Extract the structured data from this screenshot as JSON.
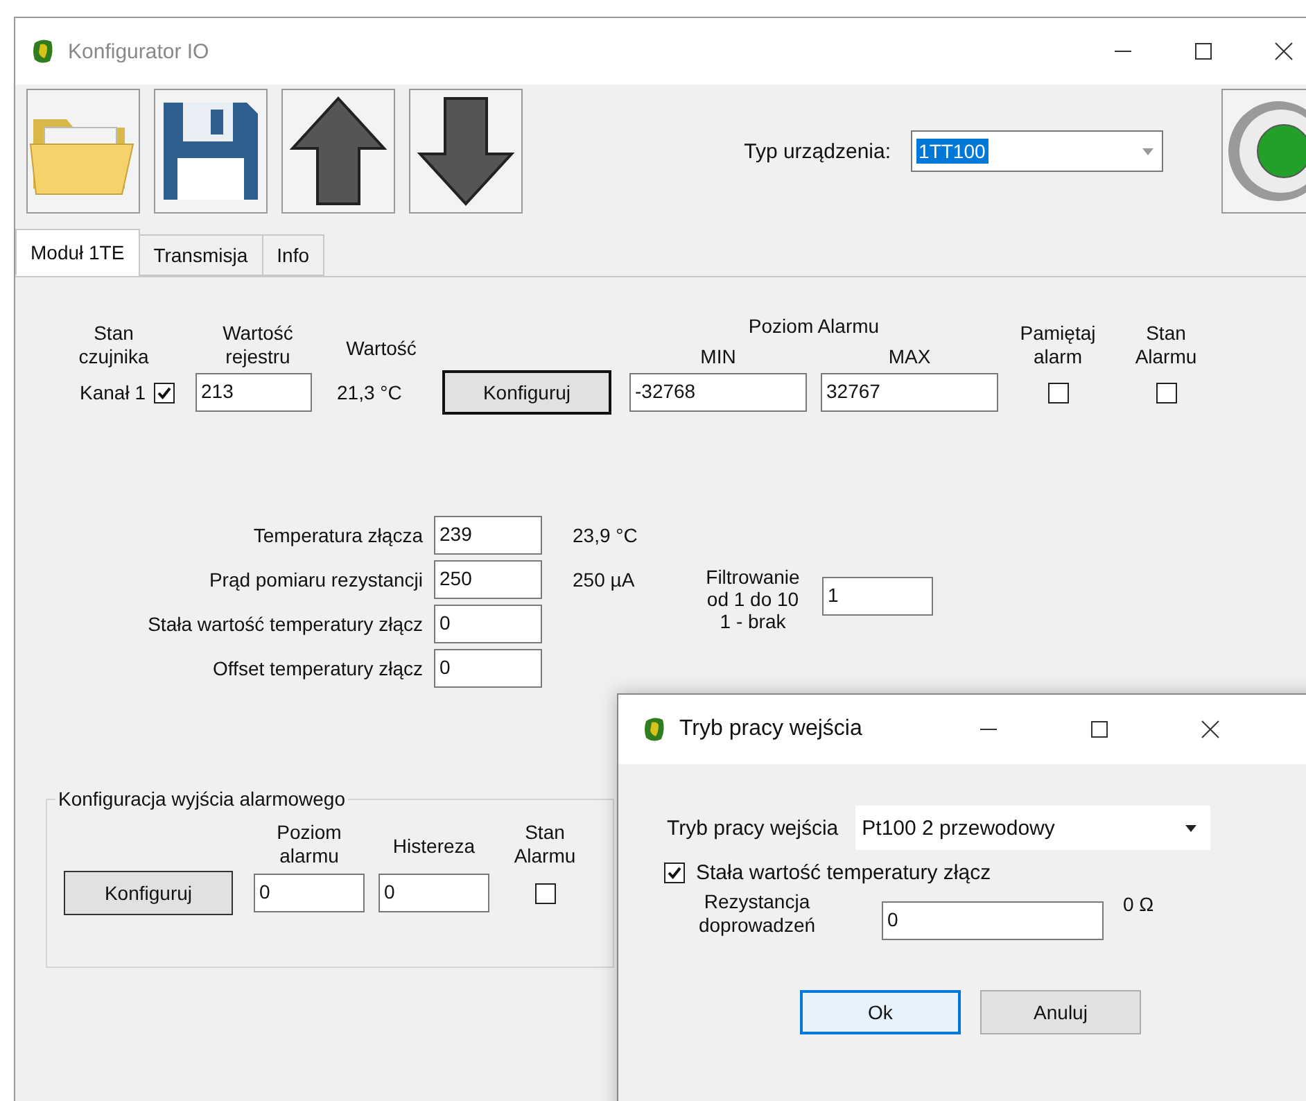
{
  "window": {
    "title": "Konfigurator IO"
  },
  "toolbar": {
    "device_type_label": "Typ urządzenia:",
    "device_type_value": "1TT100",
    "status_on": true
  },
  "tabs": [
    {
      "label": "Moduł 1TE",
      "selected": true
    },
    {
      "label": "Transmisja",
      "selected": false
    },
    {
      "label": "Info",
      "selected": false
    }
  ],
  "channel_headers": {
    "sensor_state": [
      "Stan",
      "czujnika"
    ],
    "register_value": [
      "Wartość",
      "rejestru"
    ],
    "value": [
      "Wartość"
    ],
    "alarm_level": "Poziom Alarmu",
    "min": "MIN",
    "max": "MAX",
    "remember_alarm": [
      "Pamiętaj",
      "alarm"
    ],
    "alarm_state": [
      "Stan",
      "Alarmu"
    ]
  },
  "channels": [
    {
      "name": "Kanał 1",
      "sensor_checked": true,
      "register": "213",
      "value": "21,3 °C",
      "button": "Konfiguruj",
      "min": "-32768",
      "max": "32767",
      "remember_checked": false,
      "alarm_checked": false
    }
  ],
  "parameters": [
    {
      "label": "Temperatura złącza",
      "value": "239",
      "reading": "23,9 °C"
    },
    {
      "label": "Prąd pomiaru rezystancji",
      "value": "250",
      "reading": "250 µA"
    },
    {
      "label": "Stała wartość temperatury złącz",
      "value": "0"
    },
    {
      "label": "Offset temperatury złącz",
      "value": "0"
    }
  ],
  "filter": {
    "label": [
      "Filtrowanie",
      "od 1 do 10",
      "1 - brak"
    ],
    "value": "1"
  },
  "alarm_output": {
    "title": "Konfiguracja wyjścia alarmowego",
    "button": "Konfiguruj",
    "level_header": [
      "Poziom",
      "alarmu"
    ],
    "hysteresis_header": [
      "Histereza"
    ],
    "state_header": [
      "Stan",
      "Alarmu"
    ],
    "level": "0",
    "hysteresis": "0",
    "alarm_checked": false
  },
  "dialog": {
    "title": "Tryb pracy wejścia",
    "mode_label": "Tryb pracy wejścia",
    "mode_value": "Pt100 2 przewodowy",
    "fixed_temp_label": "Stała wartość temperatury złącz",
    "fixed_temp_checked": true,
    "resistance_label": [
      "Rezystancja",
      "doprowadzeń"
    ],
    "resistance_value": "0",
    "resistance_reading": "0 Ω",
    "buttons": [
      {
        "label": "Ok",
        "default": true
      },
      {
        "label": "Anuluj",
        "default": false
      }
    ]
  }
}
